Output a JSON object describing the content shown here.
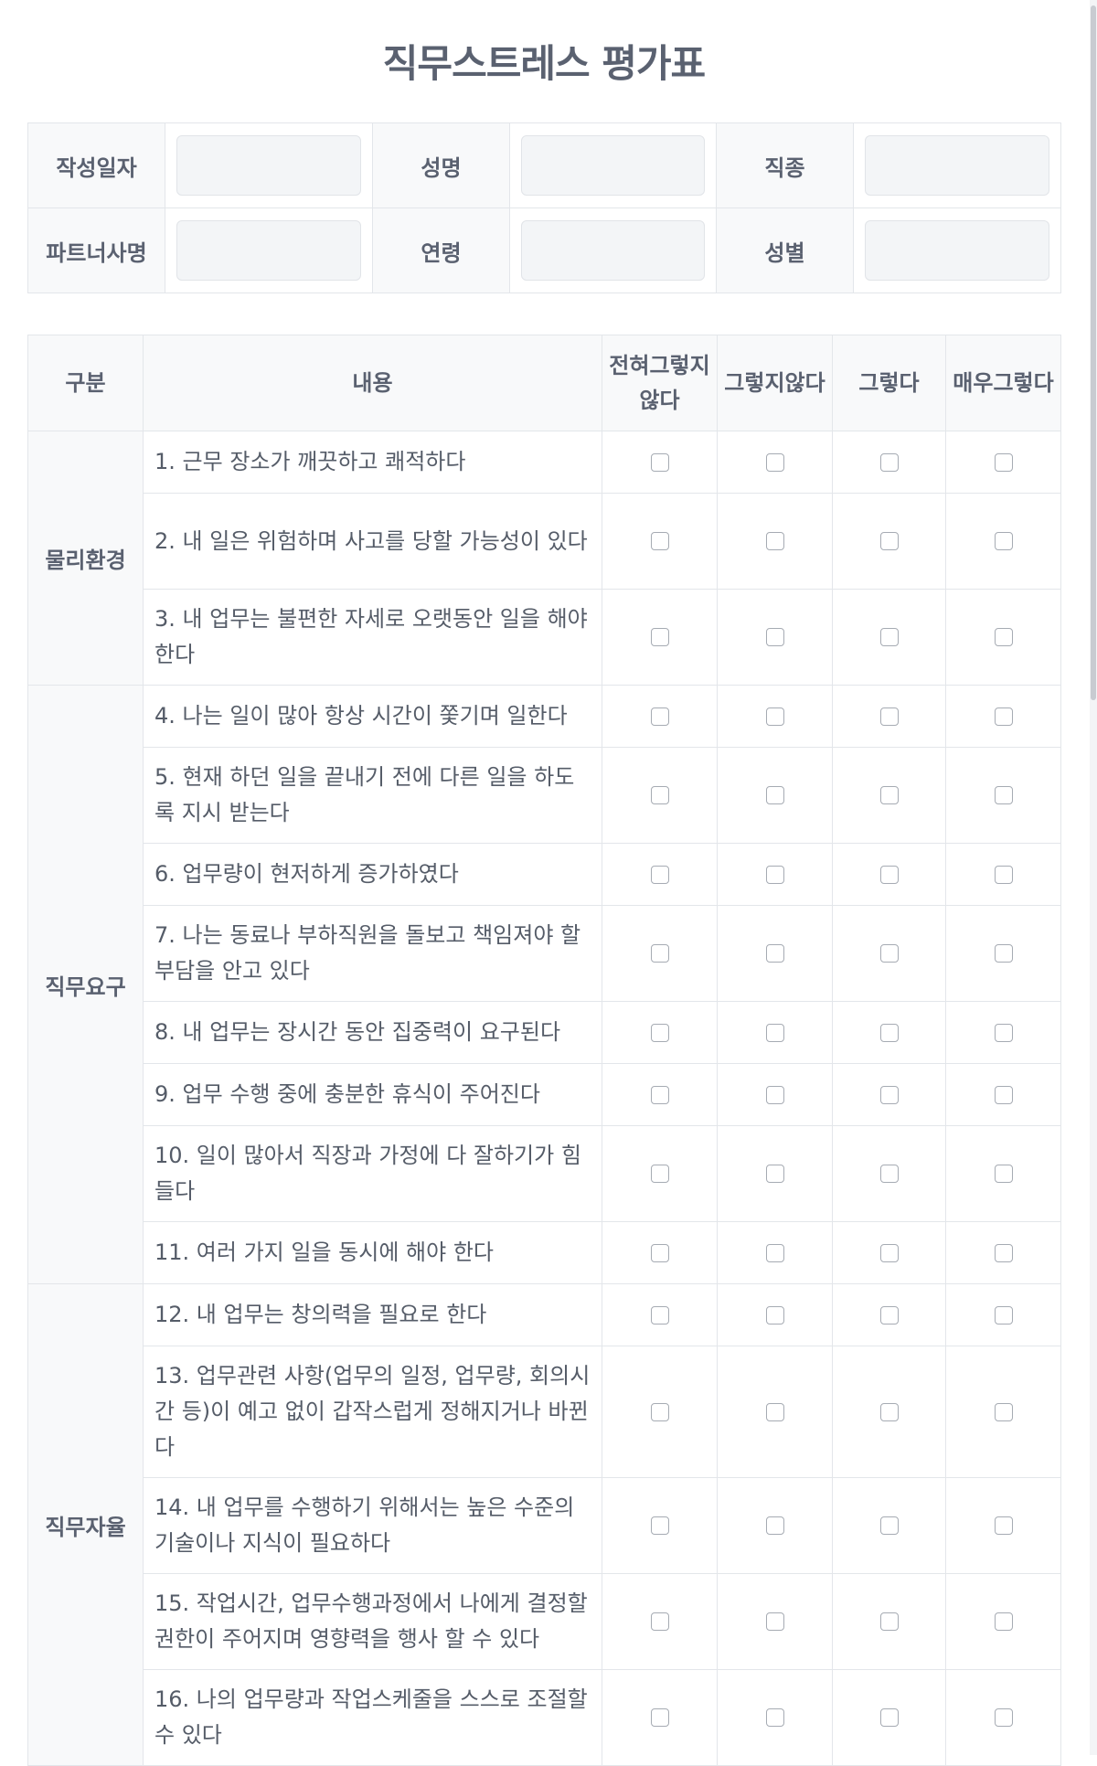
{
  "title": "직무스트레스 평가표",
  "info_form": {
    "row1": [
      {
        "label": "작성일자",
        "value": ""
      },
      {
        "label": "성명",
        "value": ""
      },
      {
        "label": "직종",
        "value": ""
      }
    ],
    "row2": [
      {
        "label": "파트너사명",
        "value": ""
      },
      {
        "label": "연령",
        "value": ""
      },
      {
        "label": "성별",
        "value": ""
      }
    ]
  },
  "survey": {
    "headers": {
      "category": "구분",
      "content": "내용",
      "options": [
        "전혀그렇지않다",
        "그렇지않다",
        "그렇다",
        "매우그렇다"
      ]
    },
    "categories": [
      "물리환경",
      "직무요구",
      "직무자율"
    ],
    "items": [
      "1. 근무 장소가 깨끗하고 쾌적하다",
      "2. 내 일은 위험하며 사고를 당할 가능성이 있다",
      "3. 내 업무는 불편한 자세로 오랫동안 일을 해야 한다",
      "4. 나는 일이 많아 항상 시간이 쫓기며 일한다",
      "5. 현재 하던 일을 끝내기 전에 다른 일을 하도록 지시 받는다",
      "6. 업무량이 현저하게 증가하였다",
      "7. 나는 동료나 부하직원을 돌보고 책임져야 할 부담을 안고 있다",
      "8. 내 업무는 장시간 동안 집중력이 요구된다",
      "9. 업무 수행 중에 충분한 휴식이 주어진다",
      "10. 일이 많아서 직장과 가정에 다 잘하기가 힘들다",
      "11. 여러 가지 일을 동시에 해야 한다",
      "12. 내 업무는 창의력을 필요로 한다",
      "13. 업무관련 사항(업무의 일정, 업무량, 회의시간 등)이 예고 없이 갑작스럽게 정해지거나 바뀐다",
      "14. 내 업무를 수행하기 위해서는 높은 수준의 기술이나 지식이 필요하다",
      "15. 작업시간, 업무수행과정에서 나에게 결정할 권한이 주어지며 영향력을 행사 할 수 있다",
      "16. 나의 업무량과 작업스케줄을 스스로 조절할 수 있다"
    ]
  }
}
